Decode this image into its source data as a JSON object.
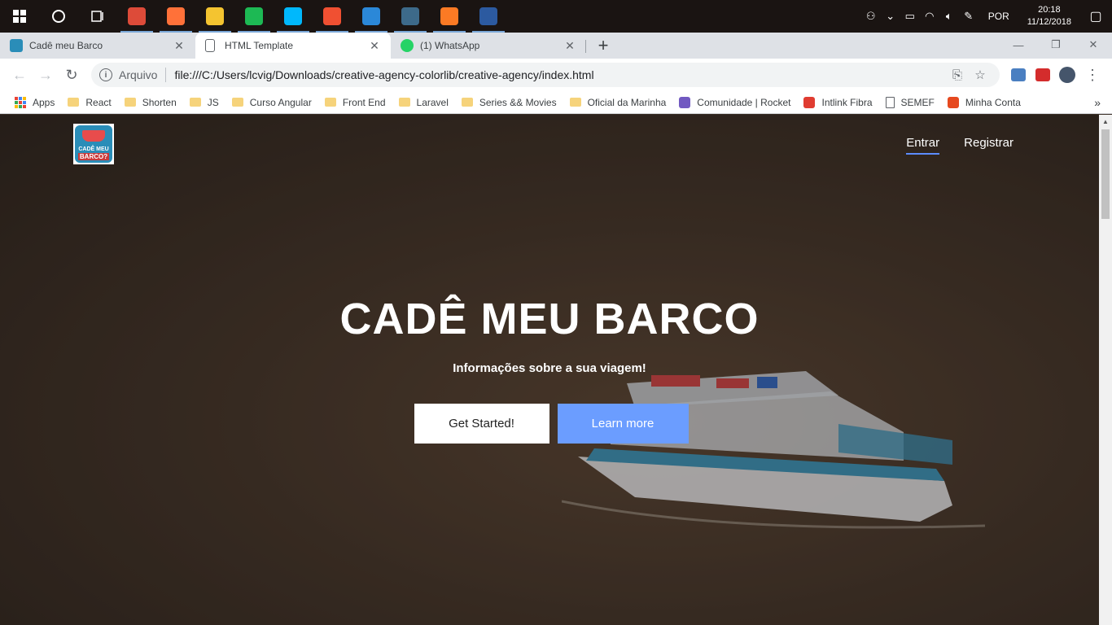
{
  "taskbar": {
    "apps": [
      {
        "icon": "chrome-icon",
        "color": "#dd4b39"
      },
      {
        "icon": "firefox-icon",
        "color": "#ff7139"
      },
      {
        "icon": "file-explorer-icon",
        "color": "#f4c430"
      },
      {
        "icon": "spotify-icon",
        "color": "#1db954"
      },
      {
        "icon": "logitech-icon",
        "color": "#00b8fc"
      },
      {
        "icon": "git-icon",
        "color": "#f05032"
      },
      {
        "icon": "vscode-icon",
        "color": "#2b88d8"
      },
      {
        "icon": "mysql-workbench-icon",
        "color": "#3d6a8a"
      },
      {
        "icon": "xampp-icon",
        "color": "#fb7a24"
      },
      {
        "icon": "powershell-icon",
        "color": "#2c5aa0"
      }
    ],
    "language": "POR",
    "time": "20:18",
    "date": "11/12/2018"
  },
  "tabs": [
    {
      "title": "Cadê meu Barco",
      "active": false
    },
    {
      "title": "HTML Template",
      "active": true
    },
    {
      "title": "(1) WhatsApp",
      "active": false
    }
  ],
  "omnibox": {
    "scheme_label": "Arquivo",
    "url": "file:///C:/Users/lcvig/Downloads/creative-agency-colorlib/creative-agency/index.html"
  },
  "bookmarks": [
    {
      "label": "Apps",
      "type": "apps"
    },
    {
      "label": "React",
      "type": "folder"
    },
    {
      "label": "Shorten",
      "type": "folder"
    },
    {
      "label": "JS",
      "type": "folder"
    },
    {
      "label": "Curso Angular",
      "type": "folder"
    },
    {
      "label": "Front End",
      "type": "folder"
    },
    {
      "label": "Laravel",
      "type": "folder"
    },
    {
      "label": "Series && Movies",
      "type": "folder"
    },
    {
      "label": "Oficial da Marinha",
      "type": "folder"
    },
    {
      "label": "Comunidade | Rocket",
      "type": "site"
    },
    {
      "label": "Intlink Fibra",
      "type": "site"
    },
    {
      "label": "SEMEF",
      "type": "page"
    },
    {
      "label": "Minha Conta",
      "type": "site"
    }
  ],
  "site": {
    "logo_text_top": "CADÊ MEU",
    "logo_text_bottom": "BARCO?",
    "nav": {
      "login": "Entrar",
      "register": "Registrar"
    },
    "hero_title": "CADÊ MEU BARCO",
    "hero_subtitle": "Informações sobre a sua viagem!",
    "btn_primary": "Get Started!",
    "btn_secondary": "Learn more"
  },
  "colors": {
    "accent": "#6b9dff",
    "nav_underline": "#5c8cff"
  }
}
